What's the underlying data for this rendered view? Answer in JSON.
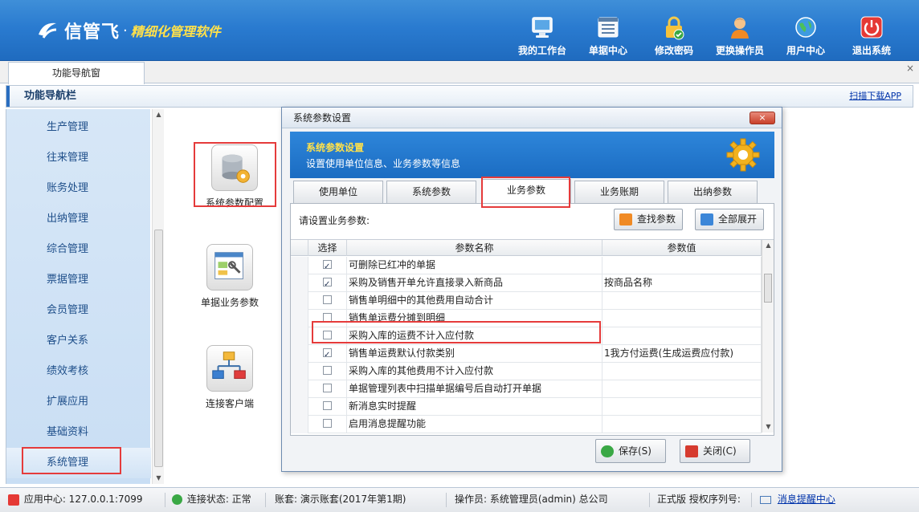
{
  "app": {
    "brand": "信管飞",
    "dot": "·",
    "slogan": "精细化管理软件"
  },
  "topnav": [
    {
      "label": "我的工作台",
      "icon": "monitor-icon"
    },
    {
      "label": "单据中心",
      "icon": "document-list-icon"
    },
    {
      "label": "修改密码",
      "icon": "lock-icon"
    },
    {
      "label": "更换操作员",
      "icon": "user-icon"
    },
    {
      "label": "用户中心",
      "icon": "globe-icon"
    },
    {
      "label": "退出系统",
      "icon": "power-icon"
    }
  ],
  "tabs": {
    "main": "功能导航窗"
  },
  "navbar": {
    "title": "功能导航栏",
    "scan_link": "扫描下载APP"
  },
  "sidebar": {
    "items": [
      {
        "label": "生产管理"
      },
      {
        "label": "往来管理"
      },
      {
        "label": "账务处理"
      },
      {
        "label": "出纳管理"
      },
      {
        "label": "综合管理"
      },
      {
        "label": "票据管理"
      },
      {
        "label": "会员管理"
      },
      {
        "label": "客户关系"
      },
      {
        "label": "绩效考核"
      },
      {
        "label": "扩展应用"
      },
      {
        "label": "基础资料"
      },
      {
        "label": "系统管理"
      }
    ],
    "selected": "系统管理"
  },
  "tools": [
    {
      "label": "系统参数配置",
      "icon": "database-gear-icon"
    },
    {
      "label": "单据业务参数",
      "icon": "form-settings-icon"
    },
    {
      "label": "连接客户端",
      "icon": "network-icon"
    }
  ],
  "dialog": {
    "title": "系统参数设置",
    "banner_title": "系统参数设置",
    "banner_subtitle": "设置使用单位信息、业务参数等信息",
    "tabs": [
      {
        "label": "使用单位"
      },
      {
        "label": "系统参数"
      },
      {
        "label": "业务参数"
      },
      {
        "label": "业务账期"
      },
      {
        "label": "出纳参数"
      }
    ],
    "active_tab": "业务参数",
    "prompt": "请设置业务参数:",
    "find_button": "查找参数",
    "expand_button": "全部展开",
    "columns": {
      "select": "选择",
      "name": "参数名称",
      "value": "参数值"
    },
    "rows": [
      {
        "checked": true,
        "name": "可删除已红冲的单据",
        "value": ""
      },
      {
        "checked": true,
        "name": "采购及销售开单允许直接录入新商品",
        "value": "按商品名称"
      },
      {
        "checked": false,
        "name": "销售单明细中的其他费用自动合计",
        "value": ""
      },
      {
        "checked": false,
        "name": "销售单运费分摊到明细",
        "value": ""
      },
      {
        "checked": false,
        "name": "采购入库的运费不计入应付款",
        "value": ""
      },
      {
        "checked": true,
        "name": "销售单运费默认付款类别",
        "value": "1我方付运费(生成运费应付款)"
      },
      {
        "checked": false,
        "name": "采购入库的其他费用不计入应付款",
        "value": ""
      },
      {
        "checked": false,
        "name": "单据管理列表中扫描单据编号后自动打开单据",
        "value": ""
      },
      {
        "checked": false,
        "name": "新消息实时提醒",
        "value": ""
      },
      {
        "checked": false,
        "name": "启用消息提醒功能",
        "value": ""
      }
    ],
    "save_button": "保存(S)",
    "close_button": "关闭(C)",
    "close_x": "×"
  },
  "statusbar": {
    "app_center": "应用中心: 127.0.0.1:7099",
    "connection": "连接状态: 正常",
    "account": "账套: 演示账套(2017年第1期)",
    "operator": "操作员: 系统管理员(admin) 总公司",
    "license": "正式版 授权序列号:",
    "message_link": "消息提醒中心"
  }
}
